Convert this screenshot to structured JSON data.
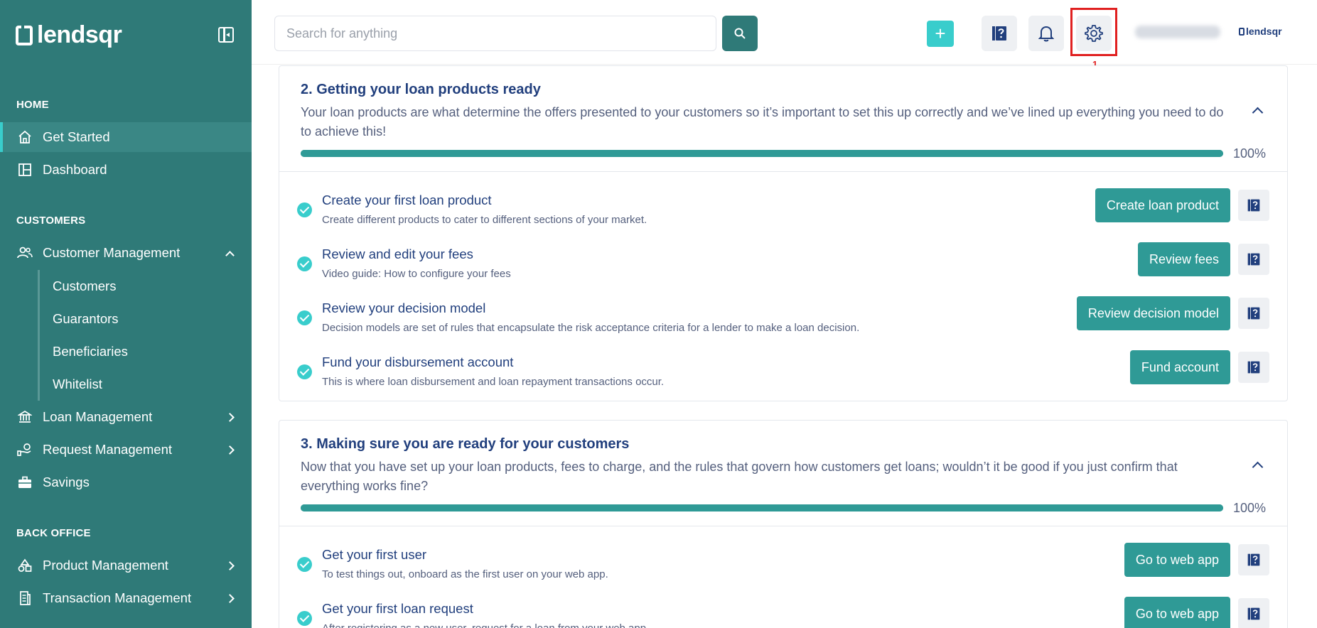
{
  "sidebar": {
    "brand": "lendsqr",
    "sections": [
      "HOME",
      "CUSTOMERS",
      "BACK OFFICE"
    ],
    "items": {
      "get_started": "Get Started",
      "dashboard": "Dashboard",
      "customer_management": "Customer Management",
      "customers": "Customers",
      "guarantors": "Guarantors",
      "beneficiaries": "Beneficiaries",
      "whitelist": "Whitelist",
      "loan_management": "Loan Management",
      "request_management": "Request Management",
      "savings": "Savings",
      "product_management": "Product Management",
      "transaction_management": "Transaction Management"
    }
  },
  "header": {
    "search_placeholder": "Search for anything",
    "plus_label": "+",
    "highlight_number": "1",
    "logo_text": "lendsqr"
  },
  "cards": [
    {
      "title": "2. Getting your loan products ready",
      "description": "Your loan products are what determine the offers presented to your customers so it’s important to set this up correctly and we’ve lined up everything you need to do to achieve this!",
      "progress": 100,
      "progress_label": "100%",
      "tasks": [
        {
          "title": "Create your first loan product",
          "subtitle": "Create different products to cater to different sections of your market.",
          "button": "Create loan product"
        },
        {
          "title": "Review and edit your fees",
          "subtitle": "Video guide: How to configure your fees",
          "button": "Review fees"
        },
        {
          "title": "Review your decision model",
          "subtitle": "Decision models are set of rules that encapsulate the risk acceptance criteria for a lender to make a loan decision.",
          "button": "Review decision model"
        },
        {
          "title": "Fund your disbursement account",
          "subtitle": "This is where loan disbursement and loan repayment transactions occur.",
          "button": "Fund account"
        }
      ]
    },
    {
      "title": "3. Making sure you are ready for your customers",
      "description": "Now that you have set up your loan products, fees to charge, and the rules that govern how customers get loans; wouldn’t it be good if you just confirm that everything works fine?",
      "progress": 100,
      "progress_label": "100%",
      "tasks": [
        {
          "title": "Get your first user",
          "subtitle": "To test things out, onboard as the first user on your web app.",
          "button": "Go to web app"
        },
        {
          "title": "Get your first loan request",
          "subtitle": "After registering as a new user, request for a loan from your web app.",
          "button": "Go to web app"
        }
      ]
    }
  ],
  "colors": {
    "sidebar_bg": "#2f7a78",
    "accent": "#39cdcc",
    "button": "#2f9a96",
    "heading": "#213f7d",
    "highlight": "#e02020"
  }
}
